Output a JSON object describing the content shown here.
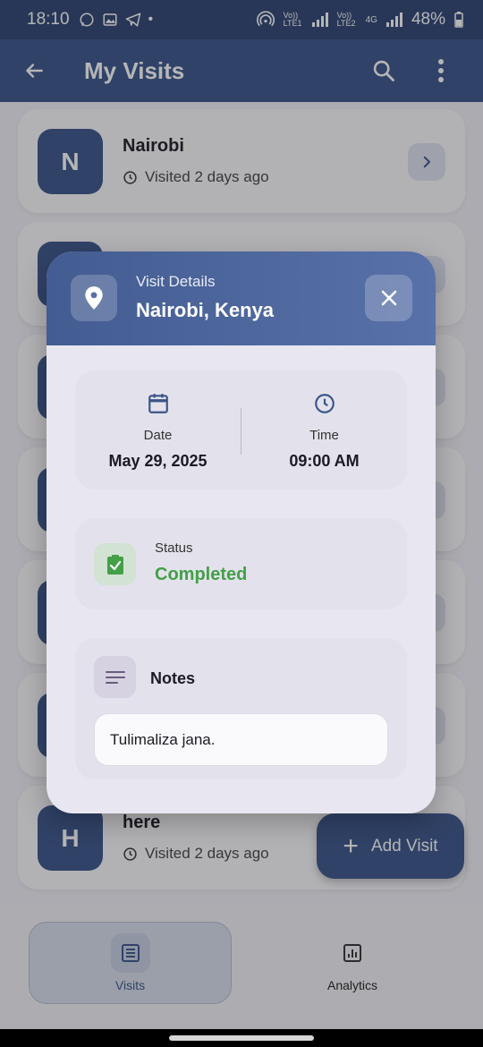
{
  "status_bar": {
    "time": "18:10",
    "network_labels": [
      "Vo)) LTE1",
      "Vo)) LTE2",
      "4G"
    ],
    "battery": "48%"
  },
  "app_bar": {
    "title": "My Visits"
  },
  "visits": [
    {
      "initial": "N",
      "title": "Nairobi",
      "subtitle": "Visited 2 days ago"
    },
    {
      "initial": "H",
      "title": "here",
      "subtitle": "Visited 2 days ago"
    }
  ],
  "fab": {
    "label": "Add Visit"
  },
  "bottom_nav": {
    "items": [
      {
        "label": "Visits",
        "selected": true
      },
      {
        "label": "Analytics",
        "selected": false
      }
    ]
  },
  "dialog": {
    "kicker": "Visit Details",
    "title": "Nairobi, Kenya",
    "date_label": "Date",
    "date_value": "May 29, 2025",
    "time_label": "Time",
    "time_value": "09:00 AM",
    "status_label": "Status",
    "status_value": "Completed",
    "notes_label": "Notes",
    "notes_value": "Tulimaliza jana."
  },
  "colors": {
    "primary": "#3a5488",
    "status_completed": "#43a047",
    "dialog_background": "#e8e7f1"
  }
}
